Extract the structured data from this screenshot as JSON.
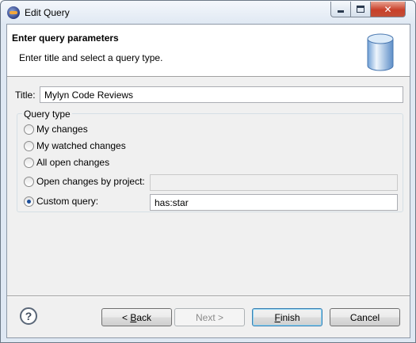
{
  "window": {
    "title": "Edit Query",
    "icon": "eclipse-icon"
  },
  "header": {
    "title": "Enter query parameters",
    "description": "Enter title and select a query type.",
    "icon": "database-icon"
  },
  "form": {
    "title_label": "Title:",
    "title_value": "Mylyn Code Reviews"
  },
  "query_type": {
    "legend": "Query type",
    "options": [
      {
        "label": "My changes",
        "checked": false
      },
      {
        "label": "My watched changes",
        "checked": false
      },
      {
        "label": "All open changes",
        "checked": false
      },
      {
        "label": "Open changes by project:",
        "checked": false
      },
      {
        "label": "Custom query:",
        "checked": true
      }
    ],
    "project_value": "",
    "custom_query_value": "has:star"
  },
  "buttons": {
    "back": {
      "prefix": "< ",
      "mnemonic": "B",
      "rest": "ack"
    },
    "next": {
      "label": "Next >",
      "enabled": false
    },
    "finish": {
      "mnemonic": "F",
      "rest": "inish",
      "default": true
    },
    "cancel": {
      "label": "Cancel"
    }
  },
  "colors": {
    "accent": "#3c7fb1",
    "window_bg": "#f0f0f0"
  }
}
